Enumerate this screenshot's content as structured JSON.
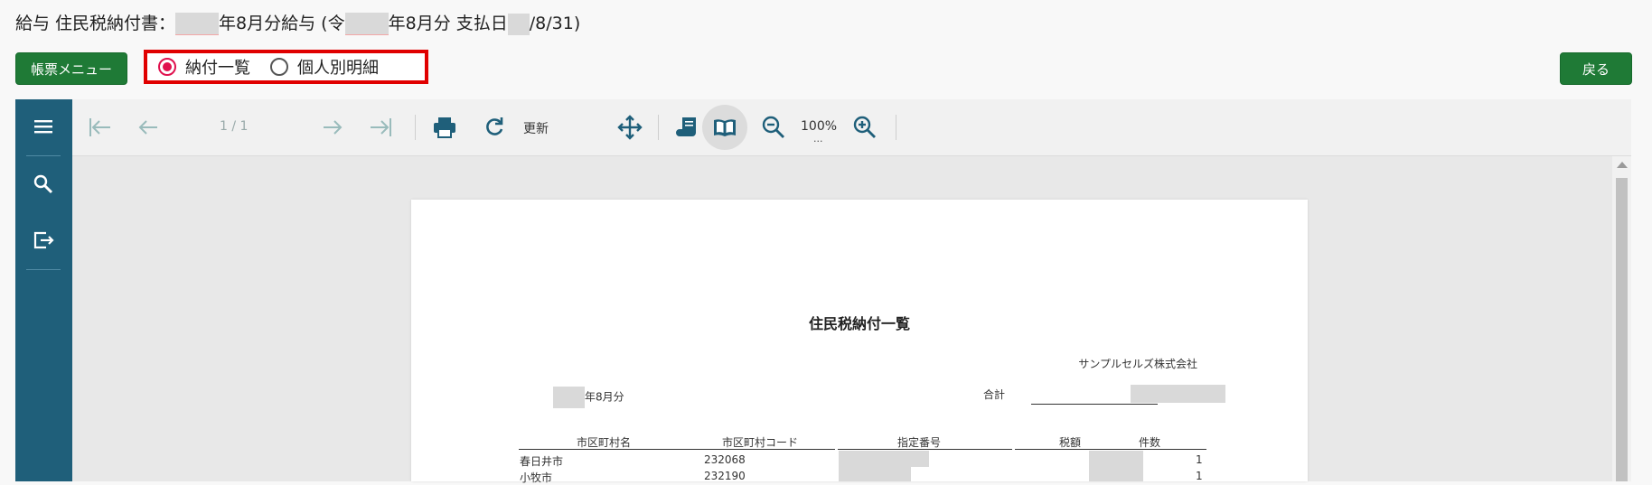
{
  "header": {
    "title_prefix": "給与 住民税納付書：",
    "title_mid": "年8月分給与 (",
    "title_mid_glyph": "令",
    "title_mid2": "年8月分 支払日",
    "title_suffix": "/8/31)"
  },
  "buttons": {
    "menu_label": "帳票メニュー",
    "back_label": "戻る"
  },
  "view_options": {
    "selected": "納付一覧",
    "options": [
      "納付一覧",
      "個人別明細"
    ]
  },
  "toolbar": {
    "page_indicator": "1 / 1",
    "refresh_label": "更新",
    "zoom_label": "100%",
    "zoom_dots": "..."
  },
  "report": {
    "title": "住民税納付一覧",
    "company": "サンプルセルズ株式会社",
    "month_suffix": "年8月分",
    "total_label": "合計",
    "columns": [
      "市区町村名",
      "市区町村コード",
      "指定番号",
      "税額",
      "件数"
    ],
    "rows": [
      {
        "name": "春日井市",
        "code": "232068",
        "count": "1"
      },
      {
        "name": "小牧市",
        "code": "232190",
        "count": "1"
      }
    ]
  },
  "colors": {
    "accent_green": "#1f7a36",
    "rail_blue": "#1f5f7a",
    "highlight_red": "#e00000",
    "radio_pink": "#e0114e"
  },
  "icons": {
    "rail": [
      "hamburger-menu-icon",
      "search-icon",
      "exit-icon"
    ],
    "toolbar": [
      "first-page-icon",
      "prev-page-icon",
      "next-page-icon",
      "last-page-icon",
      "print-icon",
      "refresh-icon",
      "move-icon",
      "scroll-view-icon",
      "book-view-icon",
      "zoom-out-icon",
      "zoom-in-icon"
    ]
  }
}
